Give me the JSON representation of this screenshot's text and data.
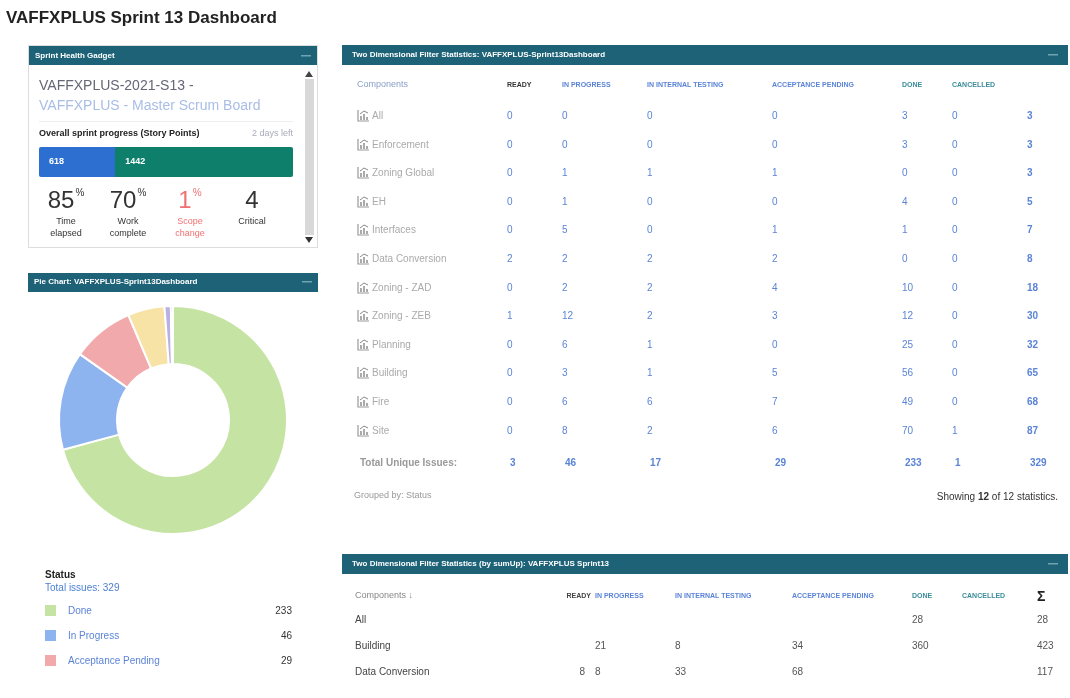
{
  "page_title": "VAFFXPLUS Sprint 13 Dashboard",
  "sprint_health": {
    "title": "Sprint Health Gadget",
    "sprint_name": "VAFFXPLUS-2021-S13 - ",
    "board_link": "VAFFXPLUS - Master Scrum Board",
    "progress_label": "Overall sprint progress (Story Points)",
    "days_left": "2 days left",
    "progress_segments": [
      {
        "value": "618",
        "level": 0.3,
        "color": "#2d6fd0"
      },
      {
        "value": "1442",
        "level": 0.7,
        "color": "#0e7f6a"
      }
    ],
    "stats": [
      {
        "value": "85",
        "unit": "%",
        "label": "Time elapsed",
        "color": "#333333"
      },
      {
        "value": "70",
        "unit": "%",
        "label": "Work complete",
        "color": "#333333"
      },
      {
        "value": "1",
        "unit": "%",
        "label": "Scope change",
        "color": "#f07070"
      },
      {
        "value": "4",
        "label": "Critical",
        "color": "#333333"
      }
    ]
  },
  "pie_chart": {
    "title": "Pie Chart: VAFFXPLUS-Sprint13Dashboard",
    "chart_data": {
      "type": "donut",
      "values": [
        70.8,
        14.0,
        8.8,
        5.2,
        0.9,
        0.3
      ],
      "colors": [
        "#c5e3a3",
        "#8db4ee",
        "#f2a9ab",
        "#f8e3a6",
        "#b9b0e4",
        "#8a8a8a"
      ]
    },
    "legend_title": "Status",
    "total": "Total issues: 329",
    "legend": [
      {
        "label": "Done",
        "value": "233",
        "color": "#c5e3a3"
      },
      {
        "label": "In Progress",
        "value": "46",
        "color": "#8db4ee"
      },
      {
        "label": "Acceptance Pending",
        "value": "29",
        "color": "#f2a9ab"
      }
    ]
  },
  "stats_table": {
    "title": "Two Dimensional Filter Statistics: VAFFXPLUS-Sprint13Dashboard",
    "columns": [
      "Components",
      "READY",
      "IN PROGRESS",
      "IN INTERNAL TESTING",
      "ACCEPTANCE PENDING",
      "DONE",
      "CANCELLED"
    ],
    "rows": [
      [
        "All",
        "0",
        "0",
        "0",
        "0",
        "3",
        "0",
        "3"
      ],
      [
        "Enforcement",
        "0",
        "0",
        "0",
        "0",
        "3",
        "0",
        "3"
      ],
      [
        "Zoning Global",
        "0",
        "1",
        "1",
        "1",
        "0",
        "0",
        "3"
      ],
      [
        "EH",
        "0",
        "1",
        "0",
        "0",
        "4",
        "0",
        "5"
      ],
      [
        "Interfaces",
        "0",
        "5",
        "0",
        "1",
        "1",
        "0",
        "7"
      ],
      [
        "Data Conversion",
        "2",
        "2",
        "2",
        "2",
        "0",
        "0",
        "8"
      ],
      [
        "Zoning - ZAD",
        "0",
        "2",
        "2",
        "4",
        "10",
        "0",
        "18"
      ],
      [
        "Zoning - ZEB",
        "1",
        "12",
        "2",
        "3",
        "12",
        "0",
        "30"
      ],
      [
        "Planning",
        "0",
        "6",
        "1",
        "0",
        "25",
        "0",
        "32"
      ],
      [
        "Building",
        "0",
        "3",
        "1",
        "5",
        "56",
        "0",
        "65"
      ],
      [
        "Fire",
        "0",
        "6",
        "6",
        "7",
        "49",
        "0",
        "68"
      ],
      [
        "Site",
        "0",
        "8",
        "2",
        "6",
        "70",
        "1",
        "87"
      ]
    ],
    "total_row": [
      "Total Unique Issues:",
      "3",
      "46",
      "17",
      "29",
      "233",
      "1",
      "329"
    ],
    "grouped_by": "Grouped by: Status",
    "showing": "Showing **12** of 12 statistics."
  },
  "sum_table": {
    "title": "Two Dimensional Filter Statistics (by sumUp): VAFFXPLUS Sprint13",
    "columns": [
      "Components ↓",
      "READY",
      "IN PROGRESS",
      "IN INTERNAL TESTING",
      "ACCEPTANCE PENDING",
      "DONE",
      "CANCELLED",
      "Σ"
    ],
    "rows": [
      [
        "All",
        null,
        null,
        null,
        null,
        "28",
        null,
        "28"
      ],
      [
        "Building",
        null,
        "21",
        "8",
        "34",
        "360",
        null,
        "423"
      ],
      [
        "Data Conversion",
        "8",
        "8",
        "33",
        "68",
        null,
        null,
        "117"
      ]
    ]
  }
}
